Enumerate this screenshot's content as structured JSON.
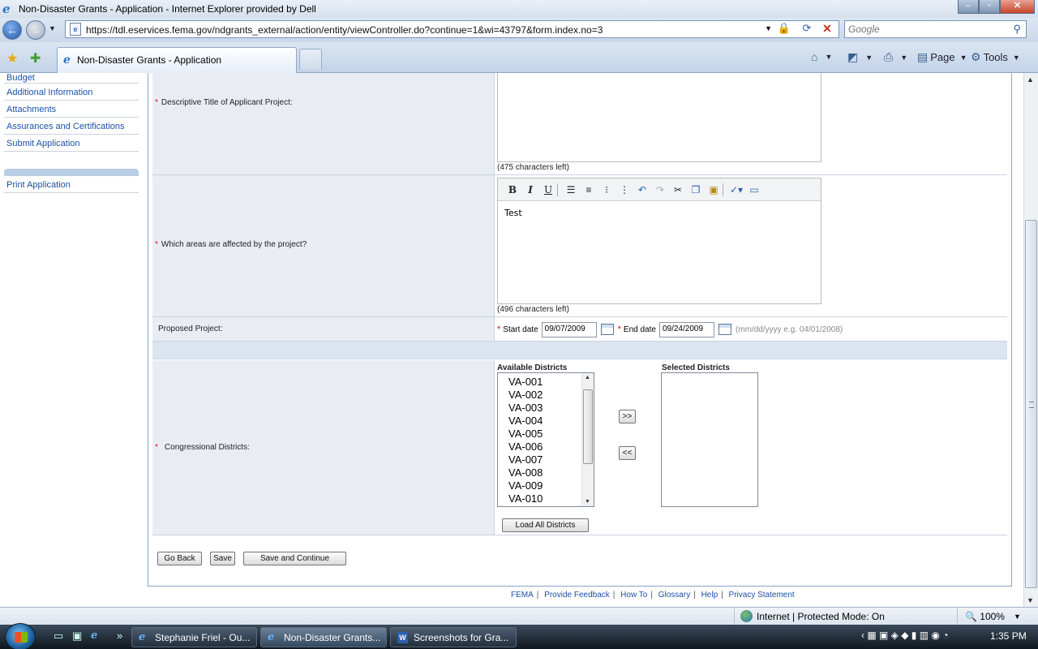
{
  "window": {
    "title": "Non-Disaster Grants - Application - Internet Explorer provided by Dell"
  },
  "browser": {
    "url": "https://tdl.eservices.fema.gov/ndgrants_external/action/entity/viewController.do?continue=1&wi=43797&form.index.no=3",
    "search_placeholder": "Google",
    "tab_title": "Non-Disaster Grants - Application",
    "page_menu": "Page",
    "tools_menu": "Tools",
    "status_zone": "Internet | Protected Mode: On",
    "zoom": "100%"
  },
  "sidebar": {
    "items": [
      {
        "label": "Budget"
      },
      {
        "label": "Additional Information"
      },
      {
        "label": "Attachments"
      },
      {
        "label": "Assurances and Certifications"
      },
      {
        "label": "Submit Application"
      }
    ],
    "print_label": "Print Application"
  },
  "form": {
    "title_field": {
      "label": "Descriptive Title of Applicant Project:",
      "chars_left": "(475 characters left)"
    },
    "areas_field": {
      "label": "Which areas are affected by the project?",
      "value": "Test",
      "chars_left": "(496 characters left)"
    },
    "proposed_project": {
      "label": "Proposed Project:",
      "start_label": "Start date",
      "start_value": "09/07/2009",
      "end_label": "End date",
      "end_value": "09/24/2009",
      "format_hint": "(mm/dd/yyyy e.g. 04/01/2008)"
    },
    "districts": {
      "label": "Congressional Districts:",
      "available_label": "Available Districts",
      "selected_label": "Selected Districts",
      "available": [
        "VA-001",
        "VA-002",
        "VA-003",
        "VA-004",
        "VA-005",
        "VA-006",
        "VA-007",
        "VA-008",
        "VA-009",
        "VA-010"
      ],
      "add_label": ">>",
      "remove_label": "<<",
      "load_all_label": "Load All Districts"
    },
    "buttons": {
      "go_back": "Go Back",
      "save": "Save",
      "save_continue": "Save and Continue"
    }
  },
  "footer": {
    "links": [
      "FEMA",
      "Provide Feedback",
      "How To",
      "Glossary",
      "Help",
      "Privacy Statement"
    ]
  },
  "taskbar": {
    "items": [
      {
        "label": "Stephanie Friel - Ou..."
      },
      {
        "label": "Non-Disaster Grants..."
      },
      {
        "label": "Screenshots for Gra..."
      }
    ],
    "time": "1:35 PM"
  }
}
